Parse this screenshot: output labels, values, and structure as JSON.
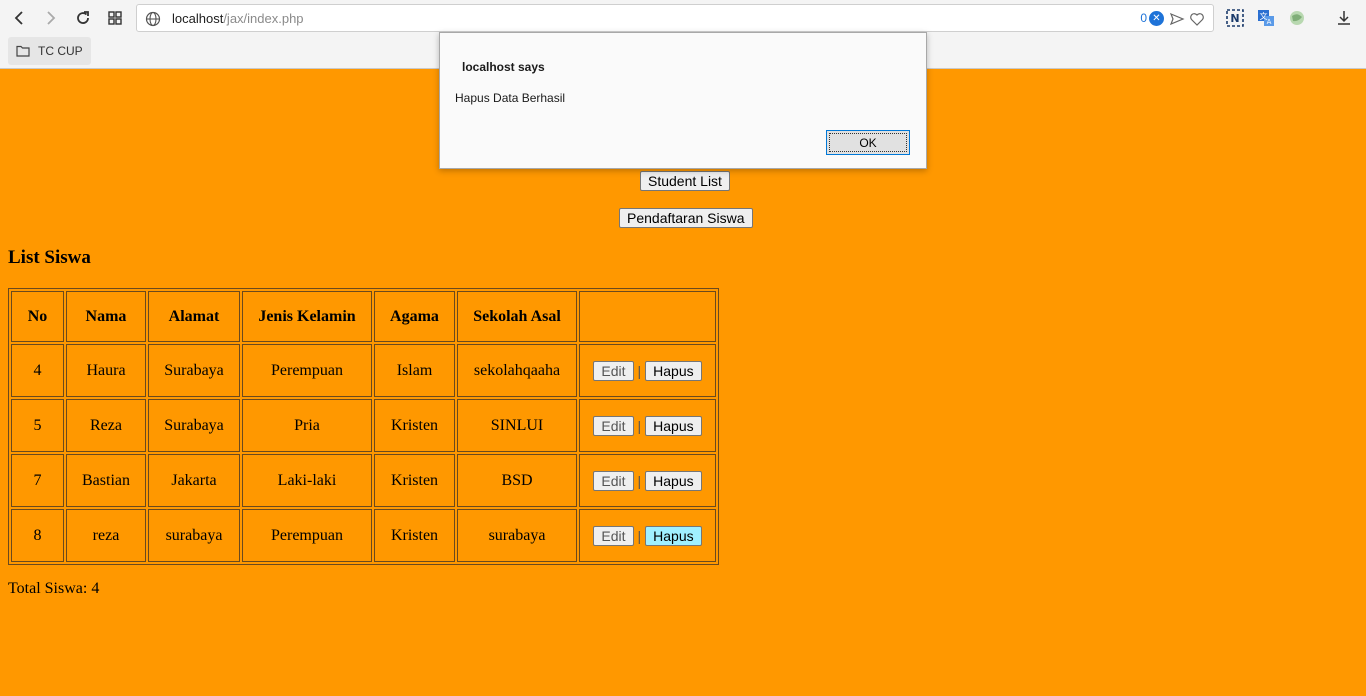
{
  "browser": {
    "url_host": "localhost",
    "url_path": "/jax/index.php",
    "blocked_count": "0",
    "bookmark": "TC CUP"
  },
  "page": {
    "student_list_button": "Student List",
    "pendaftaran_button": "Pendaftaran Siswa",
    "heading": "List Siswa",
    "table": {
      "headers": [
        "No",
        "Nama",
        "Alamat",
        "Jenis Kelamin",
        "Agama",
        "Sekolah Asal",
        ""
      ],
      "rows": [
        {
          "no": "4",
          "nama": "Haura",
          "alamat": "Surabaya",
          "jenis_kelamin": "Perempuan",
          "agama": "Islam",
          "sekolah": "sekolahqaaha"
        },
        {
          "no": "5",
          "nama": "Reza",
          "alamat": "Surabaya",
          "jenis_kelamin": "Pria",
          "agama": "Kristen",
          "sekolah": "SINLUI"
        },
        {
          "no": "7",
          "nama": "Bastian",
          "alamat": "Jakarta",
          "jenis_kelamin": "Laki-laki",
          "agama": "Kristen",
          "sekolah": "BSD"
        },
        {
          "no": "8",
          "nama": "reza",
          "alamat": "surabaya",
          "jenis_kelamin": "Perempuan",
          "agama": "Kristen",
          "sekolah": "surabaya"
        }
      ],
      "edit_label": "Edit",
      "separator": "|",
      "hapus_label": "Hapus"
    },
    "total": "Total Siswa: 4"
  },
  "dialog": {
    "title": "localhost says",
    "message": "Hapus Data Berhasil",
    "ok_label": "OK"
  }
}
